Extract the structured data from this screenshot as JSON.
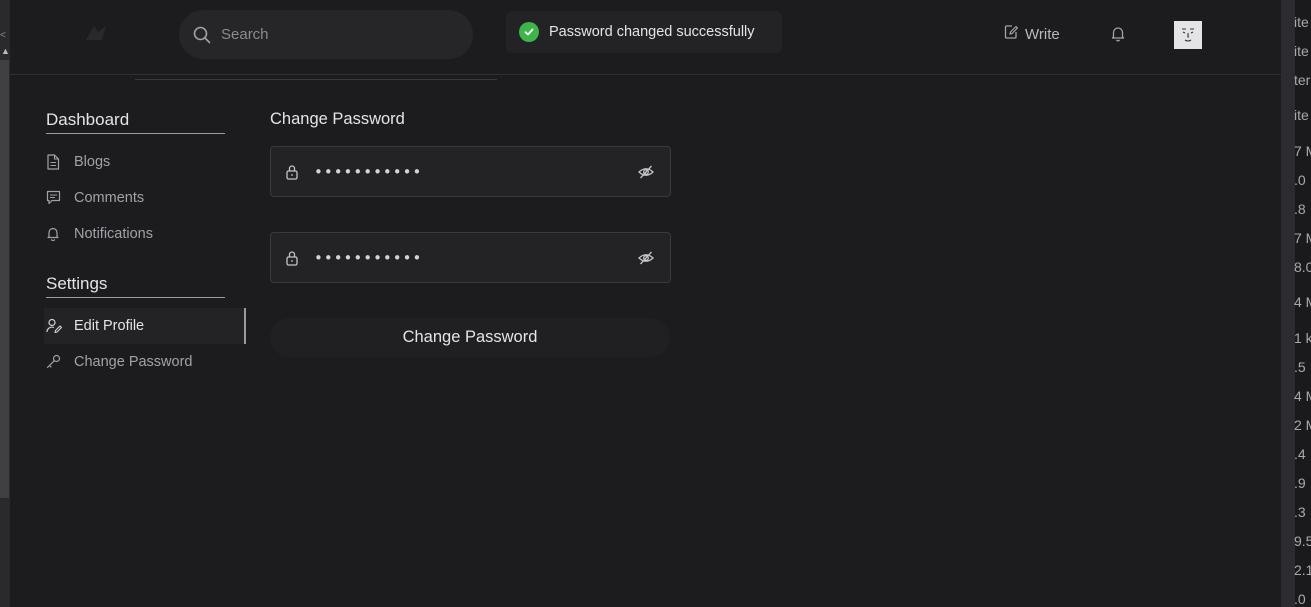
{
  "header": {
    "search_placeholder": "Search",
    "toast_message": "Password changed successfully",
    "write_label": "Write"
  },
  "sidebar": {
    "dashboard_title": "Dashboard",
    "dashboard_items": [
      {
        "label": "Blogs",
        "icon": "document-icon"
      },
      {
        "label": "Comments",
        "icon": "comment-icon"
      },
      {
        "label": "Notifications",
        "icon": "bell-icon"
      }
    ],
    "settings_title": "Settings",
    "settings_items": [
      {
        "label": "Edit Profile",
        "icon": "user-edit-icon",
        "active": true
      },
      {
        "label": "Change Password",
        "icon": "key-icon",
        "active": false
      }
    ]
  },
  "form": {
    "title": "Change Password",
    "current_password_value": "•••••••••••",
    "new_password_value": "•••••••••••",
    "submit_label": "Change Password"
  },
  "right_panel_fragments": [
    "ite",
    "ite",
    "ter",
    "ite",
    "7 M",
    ".0",
    ".8",
    "7 M",
    "8.0",
    "4 M",
    "1 k",
    ".5",
    "4 M",
    "2 M",
    ".4",
    ".9",
    ".3",
    "9.5",
    "2.1",
    ".0"
  ],
  "colors": {
    "background": "#1c1c1e",
    "success": "#3db54a"
  }
}
